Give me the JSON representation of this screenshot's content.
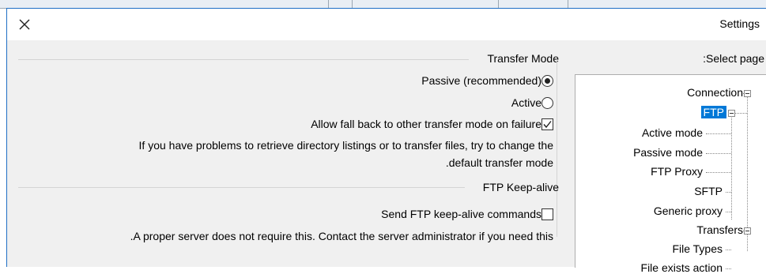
{
  "dialog": {
    "title": "Settings"
  },
  "transfer_mode": {
    "header": "Transfer Mode",
    "passive_label": "Passive (recommended)",
    "active_label": "Active",
    "fallback_label": "Allow fall back to other transfer mode on failure",
    "hint_line1": "If you have problems to retrieve directory listings or to transfer files, try to change the",
    "hint_line2": ".default transfer mode",
    "selected": "Passive (recommended)",
    "fallback_checked": true
  },
  "keepalive": {
    "header": "FTP Keep-alive",
    "send_label": "Send FTP keep-alive commands",
    "send_checked": false,
    "hint": ".A proper server does not require this. Contact the server administrator if you need this"
  },
  "tree": {
    "header": ":Select page",
    "items": [
      {
        "label": "Connection"
      },
      {
        "label": "FTP"
      },
      {
        "label": "Active mode"
      },
      {
        "label": "Passive mode"
      },
      {
        "label": "FTP Proxy"
      },
      {
        "label": "SFTP"
      },
      {
        "label": "Generic proxy"
      },
      {
        "label": "Transfers"
      },
      {
        "label": "File Types"
      },
      {
        "label": "File exists action"
      }
    ],
    "selected": "FTP"
  }
}
